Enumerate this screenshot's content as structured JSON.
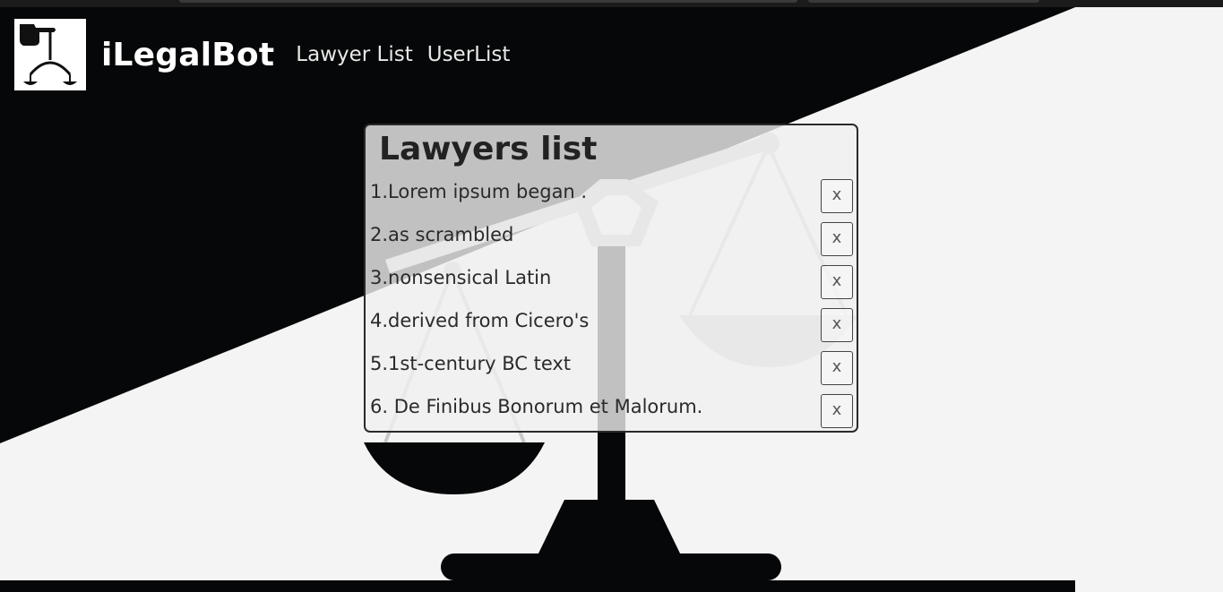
{
  "app": {
    "brand": "iLegalBot",
    "logo_icon": "scales-pointing-hand-icon"
  },
  "nav": {
    "items": [
      {
        "label": "Lawyer List"
      },
      {
        "label": "UserList"
      }
    ]
  },
  "panel": {
    "title": "Lawyers list",
    "delete_label": "x",
    "items": [
      {
        "text": "1.Lorem ipsum began ."
      },
      {
        "text": "2.as scrambled"
      },
      {
        "text": "3.nonsensical Latin"
      },
      {
        "text": "4.derived from Cicero's"
      },
      {
        "text": "5.1st-century BC text"
      },
      {
        "text": "6. De Finibus Bonorum et Malorum."
      }
    ]
  },
  "colors": {
    "dark": "#060708",
    "light": "#f4f4f4",
    "scale_overlay": "#c6c6c6"
  }
}
